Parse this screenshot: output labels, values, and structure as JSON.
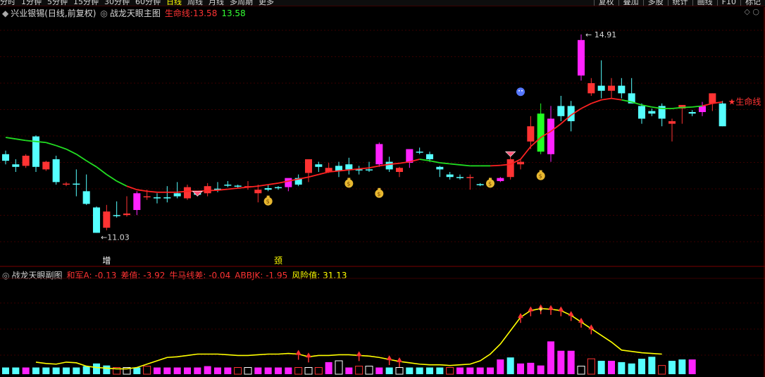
{
  "toolbar": {
    "periods": [
      "分时",
      "1分钟",
      "5分钟",
      "15分钟",
      "30分钟",
      "60分钟",
      "日线",
      "周线",
      "月线",
      "多周期",
      "更多"
    ],
    "active_period": "日线",
    "tools": [
      "复权",
      "叠加",
      "多股",
      "统计",
      "画线",
      "F10",
      "标记"
    ]
  },
  "main_panel": {
    "stock": "兴业银锡(日线,前复权)",
    "indicator": "战龙天眼主图",
    "life_label": "生命线:",
    "life_value_red": "13.58",
    "life_value_green": "13.58",
    "max_label": "14.91",
    "min_label": "11.03",
    "life_tag": "★生命线",
    "markers": [
      {
        "text": "增",
        "color": "#ffffff"
      },
      {
        "text": "颈",
        "color": "#ffff00"
      }
    ]
  },
  "sub_panel": {
    "indicator": "战龙天眼副图",
    "items": [
      {
        "label": "和军A:",
        "value": "-0.13",
        "color": "#ff3333"
      },
      {
        "label": "差值:",
        "value": "-3.92",
        "color": "#ff3333"
      },
      {
        "label": "牛马线差:",
        "value": "-0.04",
        "color": "#ff3333"
      },
      {
        "label": "ABBJK:",
        "value": "-1.95",
        "color": "#ff3333"
      },
      {
        "label": "风险值:",
        "value": "31.13",
        "color": "#ffff00"
      }
    ]
  },
  "colors": {
    "up": "#ff3333",
    "down": "#55ffff",
    "strong": "#ff22ff",
    "signal_green": "#22ff22",
    "life_up": "#ff2222",
    "life_down": "#22dd22",
    "risk_line": "#ffff00"
  },
  "chart_data": [
    {
      "type": "candlestick",
      "title": "战龙天眼主图",
      "ylim": [
        10.7,
        15.2
      ],
      "candles": [
        {
          "o": 12.55,
          "h": 12.62,
          "l": 12.35,
          "c": 12.42,
          "k": "d"
        },
        {
          "o": 12.35,
          "h": 12.45,
          "l": 12.2,
          "c": 12.3,
          "k": "d"
        },
        {
          "o": 12.32,
          "h": 12.55,
          "l": 12.28,
          "c": 12.52,
          "k": "u"
        },
        {
          "o": 12.9,
          "h": 12.92,
          "l": 12.2,
          "c": 12.3,
          "k": "d"
        },
        {
          "o": 12.25,
          "h": 12.42,
          "l": 12.22,
          "c": 12.4,
          "k": "u"
        },
        {
          "o": 12.45,
          "h": 12.52,
          "l": 11.95,
          "c": 12.0,
          "k": "d"
        },
        {
          "o": 11.97,
          "h": 12.0,
          "l": 11.92,
          "c": 11.97,
          "k": "u"
        },
        {
          "o": 11.97,
          "h": 12.25,
          "l": 11.72,
          "c": 11.97,
          "k": "d"
        },
        {
          "o": 11.82,
          "h": 12.15,
          "l": 11.55,
          "c": 11.57,
          "k": "d"
        },
        {
          "o": 11.5,
          "h": 11.52,
          "l": 11.0,
          "c": 11.0,
          "k": "d"
        },
        {
          "o": 11.1,
          "h": 11.55,
          "l": 11.05,
          "c": 11.42,
          "k": "u"
        },
        {
          "o": 11.35,
          "h": 11.62,
          "l": 11.3,
          "c": 11.33,
          "k": "d"
        },
        {
          "o": 11.35,
          "h": 11.72,
          "l": 11.32,
          "c": 11.38,
          "k": "u"
        },
        {
          "o": 11.45,
          "h": 11.82,
          "l": 11.35,
          "c": 11.78,
          "k": "s"
        },
        {
          "o": 11.7,
          "h": 11.85,
          "l": 11.65,
          "c": 11.72,
          "k": "u"
        },
        {
          "o": 11.7,
          "h": 11.78,
          "l": 11.58,
          "c": 11.68,
          "k": "d"
        },
        {
          "o": 11.7,
          "h": 11.92,
          "l": 11.6,
          "c": 11.7,
          "k": "d"
        },
        {
          "o": 11.78,
          "h": 12.0,
          "l": 11.68,
          "c": 11.72,
          "k": "d"
        },
        {
          "o": 11.68,
          "h": 11.95,
          "l": 11.65,
          "c": 11.9,
          "k": "u"
        },
        {
          "o": 11.75,
          "h": 11.82,
          "l": 11.72,
          "c": 11.78,
          "k": "d"
        },
        {
          "o": 11.78,
          "h": 11.98,
          "l": 11.72,
          "c": 11.92,
          "k": "u"
        },
        {
          "o": 11.85,
          "h": 12.0,
          "l": 11.8,
          "c": 11.87,
          "k": "d"
        },
        {
          "o": 11.95,
          "h": 12.02,
          "l": 11.9,
          "c": 11.95,
          "k": "d"
        },
        {
          "o": 11.92,
          "h": 11.95,
          "l": 11.88,
          "c": 11.93,
          "k": "d"
        },
        {
          "o": 11.92,
          "h": 12.02,
          "l": 11.85,
          "c": 11.9,
          "k": "u"
        },
        {
          "o": 11.78,
          "h": 11.95,
          "l": 11.6,
          "c": 11.85,
          "k": "u"
        },
        {
          "o": 11.85,
          "h": 11.95,
          "l": 11.82,
          "c": 11.88,
          "k": "d"
        },
        {
          "o": 11.88,
          "h": 11.92,
          "l": 11.85,
          "c": 11.9,
          "k": "d"
        },
        {
          "o": 11.9,
          "h": 12.02,
          "l": 11.82,
          "c": 12.08,
          "k": "s"
        },
        {
          "o": 11.95,
          "h": 12.15,
          "l": 11.92,
          "c": 12.08,
          "k": "d"
        },
        {
          "o": 12.18,
          "h": 12.45,
          "l": 12.0,
          "c": 12.45,
          "k": "u"
        },
        {
          "o": 12.35,
          "h": 12.4,
          "l": 12.2,
          "c": 12.3,
          "k": "d"
        },
        {
          "o": 12.2,
          "h": 12.38,
          "l": 12.18,
          "c": 12.28,
          "k": "u"
        },
        {
          "o": 12.22,
          "h": 12.4,
          "l": 12.1,
          "c": 12.32,
          "k": "d"
        },
        {
          "o": 12.25,
          "h": 12.48,
          "l": 12.15,
          "c": 12.35,
          "k": "d"
        },
        {
          "o": 12.25,
          "h": 12.32,
          "l": 12.15,
          "c": 12.25,
          "k": "d"
        },
        {
          "o": 12.25,
          "h": 12.4,
          "l": 12.2,
          "c": 12.25,
          "k": "d"
        },
        {
          "o": 12.35,
          "h": 12.78,
          "l": 12.3,
          "c": 12.75,
          "k": "s"
        },
        {
          "o": 12.4,
          "h": 12.5,
          "l": 12.2,
          "c": 12.25,
          "k": "d"
        },
        {
          "o": 12.2,
          "h": 12.3,
          "l": 12.1,
          "c": 12.28,
          "k": "u"
        },
        {
          "o": 12.38,
          "h": 12.55,
          "l": 12.28,
          "c": 12.65,
          "k": "s"
        },
        {
          "o": 12.58,
          "h": 12.68,
          "l": 12.55,
          "c": 12.6,
          "k": "d"
        },
        {
          "o": 12.55,
          "h": 12.6,
          "l": 12.4,
          "c": 12.45,
          "k": "d"
        },
        {
          "o": 12.3,
          "h": 12.32,
          "l": 12.1,
          "c": 12.25,
          "k": "d"
        },
        {
          "o": 12.15,
          "h": 12.2,
          "l": 12.05,
          "c": 12.1,
          "k": "d"
        },
        {
          "o": 12.1,
          "h": 12.15,
          "l": 12.05,
          "c": 12.08,
          "k": "d"
        },
        {
          "o": 12.08,
          "h": 12.15,
          "l": 11.85,
          "c": 12.1,
          "k": "u"
        },
        {
          "o": 11.95,
          "h": 11.98,
          "l": 11.92,
          "c": 11.96,
          "k": "d"
        },
        {
          "o": 11.97,
          "h": 12.02,
          "l": 11.9,
          "c": 12.02,
          "k": "u"
        },
        {
          "o": 12.02,
          "h": 12.1,
          "l": 12.0,
          "c": 12.08,
          "k": "s"
        },
        {
          "o": 12.1,
          "h": 12.5,
          "l": 12.05,
          "c": 12.45,
          "k": "u"
        },
        {
          "o": 12.35,
          "h": 12.45,
          "l": 12.25,
          "c": 12.4,
          "k": "u"
        },
        {
          "o": 12.8,
          "h": 13.3,
          "l": 12.65,
          "c": 13.1,
          "k": "u"
        },
        {
          "o": 13.35,
          "h": 13.55,
          "l": 12.55,
          "c": 12.6,
          "k": "g"
        },
        {
          "o": 12.55,
          "h": 13.5,
          "l": 12.4,
          "c": 13.25,
          "k": "s"
        },
        {
          "o": 13.3,
          "h": 13.7,
          "l": 13.2,
          "c": 13.5,
          "k": "d"
        },
        {
          "o": 13.2,
          "h": 13.6,
          "l": 13.0,
          "c": 13.5,
          "k": "d"
        },
        {
          "o": 14.1,
          "h": 14.91,
          "l": 14.0,
          "c": 14.8,
          "k": "s"
        },
        {
          "o": 13.75,
          "h": 14.05,
          "l": 13.7,
          "c": 13.95,
          "k": "u"
        },
        {
          "o": 13.8,
          "h": 14.4,
          "l": 13.65,
          "c": 13.9,
          "k": "d"
        },
        {
          "o": 13.8,
          "h": 14.05,
          "l": 13.65,
          "c": 13.9,
          "k": "u"
        },
        {
          "o": 13.9,
          "h": 14.05,
          "l": 13.65,
          "c": 13.75,
          "k": "d"
        },
        {
          "o": 13.75,
          "h": 14.05,
          "l": 13.6,
          "c": 13.55,
          "k": "d"
        },
        {
          "o": 13.5,
          "h": 13.55,
          "l": 13.15,
          "c": 13.25,
          "k": "d"
        },
        {
          "o": 13.4,
          "h": 13.45,
          "l": 13.3,
          "c": 13.35,
          "k": "d"
        },
        {
          "o": 13.5,
          "h": 13.55,
          "l": 13.1,
          "c": 13.25,
          "k": "d"
        },
        {
          "o": 13.2,
          "h": 13.25,
          "l": 12.8,
          "c": 13.15,
          "k": "u"
        },
        {
          "o": 13.45,
          "h": 13.5,
          "l": 13.15,
          "c": 13.52,
          "k": "u"
        },
        {
          "o": 13.38,
          "h": 13.42,
          "l": 13.3,
          "c": 13.35,
          "k": "d"
        },
        {
          "o": 13.38,
          "h": 13.58,
          "l": 13.3,
          "c": 13.5,
          "k": "s"
        },
        {
          "o": 13.55,
          "h": 13.75,
          "l": 13.4,
          "c": 13.75,
          "k": "u"
        },
        {
          "o": 13.55,
          "h": 13.6,
          "l": 13.1,
          "c": 13.1,
          "k": "d"
        }
      ],
      "life_line": [
        12.88,
        12.85,
        12.82,
        12.8,
        12.78,
        12.72,
        12.65,
        12.55,
        12.42,
        12.3,
        12.15,
        12.02,
        11.92,
        11.85,
        11.82,
        11.8,
        11.8,
        11.8,
        11.82,
        11.82,
        11.83,
        11.84,
        11.86,
        11.88,
        11.9,
        11.92,
        11.95,
        11.98,
        12.02,
        12.06,
        12.1,
        12.15,
        12.2,
        12.22,
        12.24,
        12.26,
        12.28,
        12.32,
        12.35,
        12.37,
        12.4,
        12.45,
        12.42,
        12.38,
        12.36,
        12.34,
        12.32,
        12.32,
        12.32,
        12.33,
        12.35,
        12.45,
        12.7,
        12.88,
        13.0,
        13.15,
        13.32,
        13.45,
        13.55,
        13.62,
        13.65,
        13.62,
        13.58,
        13.52,
        13.48,
        13.45,
        13.45,
        13.47,
        13.48,
        13.5,
        13.55,
        13.58
      ],
      "life_line_green_ranges": [
        [
          0,
          12
        ],
        [
          41,
          48
        ],
        [
          61,
          69
        ]
      ],
      "signal_icons": [
        {
          "i": 19,
          "kind": "diamond",
          "y": 11.82
        },
        {
          "i": 26,
          "kind": "bag",
          "y": 11.65
        },
        {
          "i": 34,
          "kind": "bag",
          "y": 12.0
        },
        {
          "i": 37,
          "kind": "bag",
          "y": 11.8
        },
        {
          "i": 48,
          "kind": "bag",
          "y": 12.0
        },
        {
          "i": 50,
          "kind": "diamond",
          "y": 12.6
        },
        {
          "i": 53,
          "kind": "bag",
          "y": 12.15
        },
        {
          "i": 51,
          "kind": "face",
          "y": 13.78
        }
      ]
    },
    {
      "type": "bar",
      "title": "战龙天眼副图",
      "ylim": [
        0,
        14
      ],
      "bars": [
        {
          "v": 1.0,
          "k": "d"
        },
        {
          "v": 1.0,
          "k": "d"
        },
        {
          "v": 1.0,
          "k": "s"
        },
        {
          "v": 1.0,
          "k": "d"
        },
        {
          "v": 1.0,
          "k": "d"
        },
        {
          "v": 1.0,
          "k": "d"
        },
        {
          "v": 1.0,
          "k": "d"
        },
        {
          "v": 1.0,
          "k": "d"
        },
        {
          "v": 1.2,
          "k": "d"
        },
        {
          "v": 1.6,
          "k": "d"
        },
        {
          "v": 1.3,
          "k": "d"
        },
        {
          "v": 1.0,
          "k": "o"
        },
        {
          "v": 1.0,
          "k": "o"
        },
        {
          "v": 1.0,
          "k": "d"
        },
        {
          "v": 1.2,
          "k": "o"
        },
        {
          "v": 1.0,
          "k": "s"
        },
        {
          "v": 1.0,
          "k": "s"
        },
        {
          "v": 1.0,
          "k": "s"
        },
        {
          "v": 1.0,
          "k": "s"
        },
        {
          "v": 1.0,
          "k": "s"
        },
        {
          "v": 1.2,
          "k": "s"
        },
        {
          "v": 1.0,
          "k": "s"
        },
        {
          "v": 1.0,
          "k": "s"
        },
        {
          "v": 1.0,
          "k": "o"
        },
        {
          "v": 1.0,
          "k": "o"
        },
        {
          "v": 1.0,
          "k": "s"
        },
        {
          "v": 1.0,
          "k": "s"
        },
        {
          "v": 1.0,
          "k": "s"
        },
        {
          "v": 1.0,
          "k": "s"
        },
        {
          "v": 1.0,
          "k": "o"
        },
        {
          "v": 1.0,
          "k": "o"
        },
        {
          "v": 1.0,
          "k": "o"
        },
        {
          "v": 1.8,
          "k": "s"
        },
        {
          "v": 2.0,
          "k": "o"
        },
        {
          "v": 1.0,
          "k": "s"
        },
        {
          "v": 1.2,
          "k": "o"
        },
        {
          "v": 1.2,
          "k": "o"
        },
        {
          "v": 1.0,
          "k": "s"
        },
        {
          "v": 1.0,
          "k": "d"
        },
        {
          "v": 1.0,
          "k": "o"
        },
        {
          "v": 1.0,
          "k": "d"
        },
        {
          "v": 1.0,
          "k": "d"
        },
        {
          "v": 1.0,
          "k": "d"
        },
        {
          "v": 1.0,
          "k": "d"
        },
        {
          "v": 1.0,
          "k": "o"
        },
        {
          "v": 1.0,
          "k": "s"
        },
        {
          "v": 1.0,
          "k": "s"
        },
        {
          "v": 1.0,
          "k": "s"
        },
        {
          "v": 1.0,
          "k": "s"
        },
        {
          "v": 2.2,
          "k": "s"
        },
        {
          "v": 2.5,
          "k": "d"
        },
        {
          "v": 1.6,
          "k": "s"
        },
        {
          "v": 1.7,
          "k": "s"
        },
        {
          "v": 1.3,
          "k": "s"
        },
        {
          "v": 4.9,
          "k": "s"
        },
        {
          "v": 3.5,
          "k": "s"
        },
        {
          "v": 3.5,
          "k": "s"
        },
        {
          "v": 1.2,
          "k": "o"
        },
        {
          "v": 2.3,
          "k": "o"
        },
        {
          "v": 2.0,
          "k": "d"
        },
        {
          "v": 2.0,
          "k": "s"
        },
        {
          "v": 1.8,
          "k": "d"
        },
        {
          "v": 1.6,
          "k": "d"
        },
        {
          "v": 2.3,
          "k": "d"
        },
        {
          "v": 2.6,
          "k": "d"
        },
        {
          "v": 1.3,
          "k": "o"
        },
        {
          "v": 2.0,
          "k": "d"
        },
        {
          "v": 2.2,
          "k": "d"
        },
        {
          "v": 2.2,
          "k": "s"
        }
      ],
      "risk_line": [
        1.8,
        1.6,
        1.5,
        1.8,
        1.7,
        1.2,
        1.0,
        0.9,
        0.8,
        0.8,
        1.0,
        1.5,
        2.0,
        2.5,
        2.6,
        2.8,
        3.0,
        3.0,
        3.0,
        2.9,
        2.8,
        2.8,
        2.9,
        3.0,
        3.0,
        3.1,
        3.0,
        2.6,
        2.8,
        2.8,
        2.9,
        2.9,
        2.8,
        2.7,
        2.5,
        2.2,
        1.9,
        1.7,
        1.5,
        1.4,
        1.4,
        1.3,
        1.4,
        1.5,
        2.0,
        3.0,
        4.5,
        6.5,
        8.5,
        9.5,
        9.8,
        9.7,
        9.5,
        8.8,
        7.8,
        6.8,
        5.8,
        4.8,
        3.6,
        3.4,
        3.2,
        3.1,
        3.0
      ],
      "risk_x_start": 3,
      "arrows": [
        29,
        30,
        35,
        38,
        39,
        51,
        52,
        53,
        54,
        55,
        56,
        57,
        58,
        66
      ],
      "stars": [
        53
      ]
    }
  ]
}
